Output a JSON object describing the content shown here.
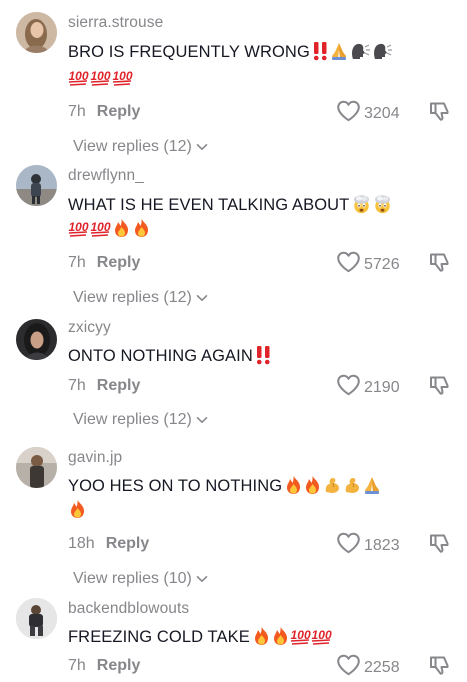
{
  "comments": [
    {
      "username": "sierra.strouse",
      "text": "BRO IS FREQUENTLY WRONG",
      "inline_emojis": [
        "double-exclamation",
        "folded-hands",
        "speaking-head",
        "speaking-head"
      ],
      "second_line_emojis": [
        "hundred-points",
        "hundred-points",
        "hundred-points"
      ],
      "time": "7h",
      "reply_label": "Reply",
      "likes": "3204",
      "view_replies": "View replies (12)"
    },
    {
      "username": "drewflynn_",
      "text": "WHAT IS HE EVEN TALKING ABOUT",
      "inline_emojis": [
        "exploding-head",
        "exploding-head"
      ],
      "second_line_emojis": [
        "hundred-points",
        "hundred-points",
        "fire",
        "fire"
      ],
      "time": "7h",
      "reply_label": "Reply",
      "likes": "5726",
      "view_replies": "View replies (12)"
    },
    {
      "username": "zxicyy",
      "text": "ONTO NOTHING AGAIN",
      "inline_emojis": [
        "double-exclamation"
      ],
      "second_line_emojis": [],
      "time": "7h",
      "reply_label": "Reply",
      "likes": "2190",
      "view_replies": "View replies (12)"
    },
    {
      "username": "gavin.jp",
      "text": "YOO HES ON TO NOTHING",
      "inline_emojis": [
        "fire",
        "fire",
        "flexed-biceps",
        "flexed-biceps",
        "folded-hands"
      ],
      "second_line_emojis": [
        "fire"
      ],
      "time": "18h",
      "reply_label": "Reply",
      "likes": "1823",
      "view_replies": "View replies (10)"
    },
    {
      "username": "backendblowouts",
      "text": "FREEZING COLD TAKE",
      "inline_emojis": [
        "fire",
        "fire",
        "hundred-points",
        "hundred-points"
      ],
      "second_line_emojis": [],
      "time": "7h",
      "reply_label": "Reply",
      "likes": "2258",
      "view_replies": ""
    }
  ],
  "icons": {
    "like": "heart-outline-icon",
    "dislike": "thumbs-down-outline-icon",
    "expand": "chevron-down-icon"
  },
  "colors": {
    "text": "#161823",
    "secondary": "#86878b",
    "emoji_red": "#e0242c"
  }
}
